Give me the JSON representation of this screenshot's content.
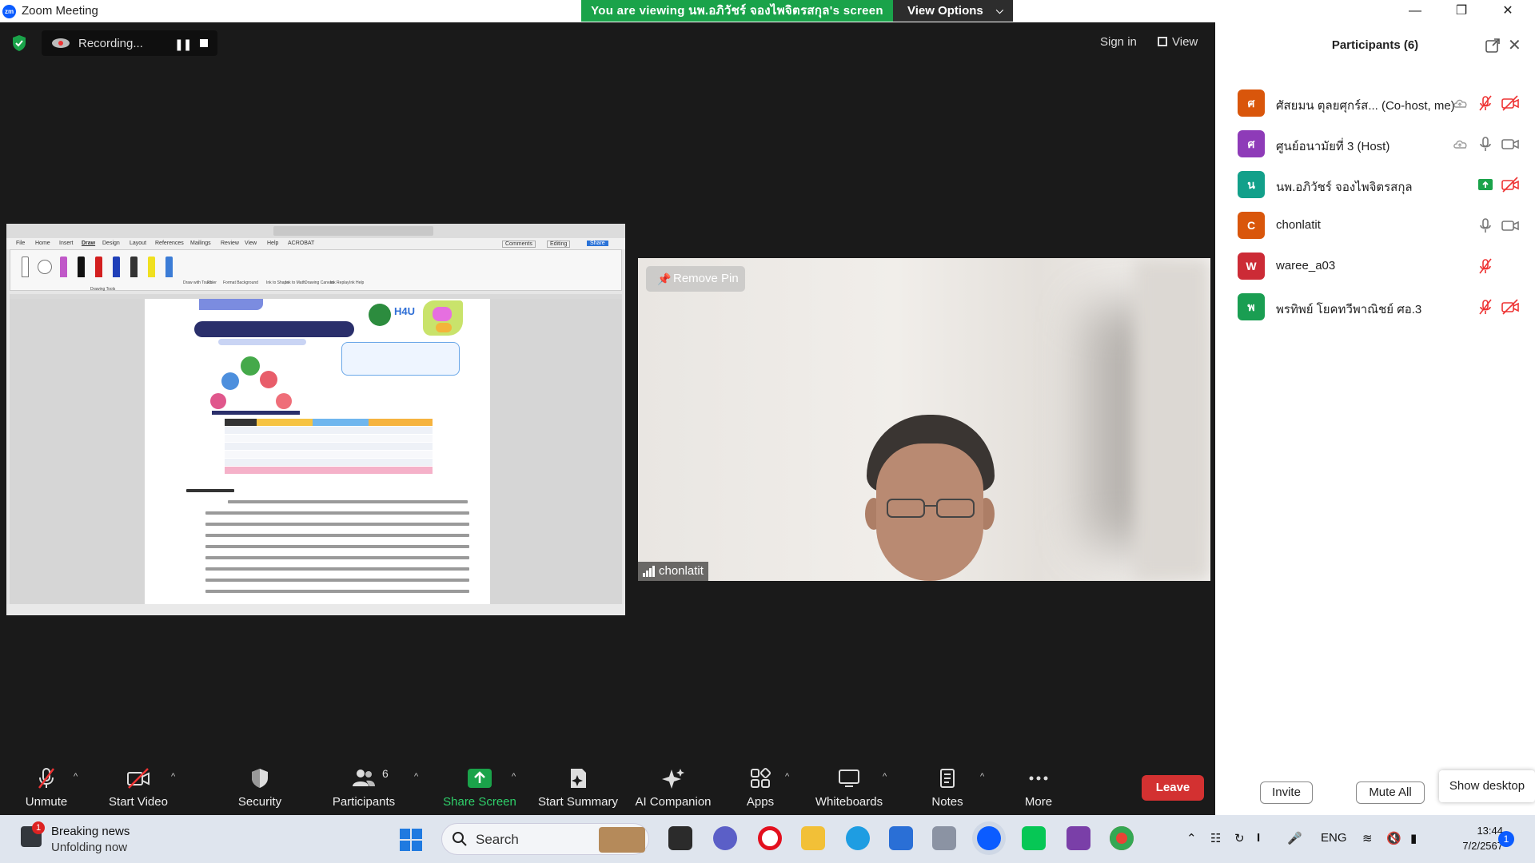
{
  "window": {
    "title": "Zoom Meeting",
    "app_icon": "zm",
    "controls": [
      "minimize-icon",
      "restore-icon",
      "close-icon"
    ]
  },
  "banner": {
    "viewing_text": "You are viewing นพ.อภิวัชร์ จองไพจิตรสกุล's screen",
    "view_options": "View Options",
    "accent": "#1aa34a"
  },
  "top": {
    "recording_label": "Recording...",
    "sign_in": "Sign in",
    "view": "View"
  },
  "video": {
    "remove_pin": "Remove Pin",
    "name": "chonlatit"
  },
  "participants": {
    "title": "Participants (6)",
    "list": [
      {
        "initial": "ศ",
        "name": "ศัสยมน ตุลยศุกร์ส... (Co-host, me)",
        "color": "#d9560b",
        "mic": "muted",
        "video": "off",
        "cloud": true
      },
      {
        "initial": "ศ",
        "name": "ศูนย์อนามัยที่ 3 (Host)",
        "color": "#8e3bb8",
        "mic": "on",
        "video": "on",
        "cloud": true
      },
      {
        "initial": "น",
        "name": "นพ.อภิวัชร์ จองไพจิตรสกุล",
        "color": "#12a08a",
        "mic": "sharing",
        "video": "off",
        "cloud": false
      },
      {
        "initial": "C",
        "name": "chonlatit",
        "color": "#d9560b",
        "mic": "on",
        "video": "on",
        "cloud": false
      },
      {
        "initial": "W",
        "name": "waree_a03",
        "color": "#cc2b36",
        "mic": "muted",
        "video": "none",
        "cloud": false
      },
      {
        "initial": "พ",
        "name": "พรทิพย์ โยคทวีพาณิชย์ ศอ.3",
        "color": "#1a9e52",
        "mic": "muted",
        "video": "off",
        "cloud": false
      }
    ],
    "invite": "Invite",
    "mute_all": "Mute All",
    "show_desktop": "Show desktop"
  },
  "toolbar": {
    "unmute": "Unmute",
    "start_video": "Start Video",
    "security": "Security",
    "participants": "Participants",
    "participants_count": "6",
    "share_screen": "Share Screen",
    "start_summary": "Start Summary",
    "ai_companion": "AI Companion",
    "apps": "Apps",
    "whiteboards": "Whiteboards",
    "notes": "Notes",
    "more": "More",
    "leave": "Leave",
    "leave_color": "#d33131",
    "share_color": "#1aa34a"
  },
  "taskbar": {
    "news_title": "Breaking news",
    "news_sub": "Unfolding now",
    "news_badge": "1",
    "search": "Search",
    "lang": "ENG",
    "time": "13:44",
    "date": "7/2/2567",
    "notif_count": "1"
  },
  "shared_doc": {
    "menu": [
      "File",
      "Home",
      "Insert",
      "Draw",
      "Design",
      "Layout",
      "References",
      "Mailings",
      "Review",
      "View",
      "Help",
      "ACROBAT"
    ],
    "ribbon_groups": [
      "Drawing Tools",
      "Touch",
      "Stencils",
      "Edit",
      "Convert",
      "Insert",
      "Replay",
      "Help"
    ],
    "tools": [
      "Draw with Touch",
      "Ruler",
      "Format Background",
      "Ink to Shape",
      "Ink to Math",
      "Drawing Canvas",
      "Ink Replay",
      "Ink Help"
    ],
    "buttons": [
      "Comments",
      "Editing",
      "Share"
    ]
  }
}
